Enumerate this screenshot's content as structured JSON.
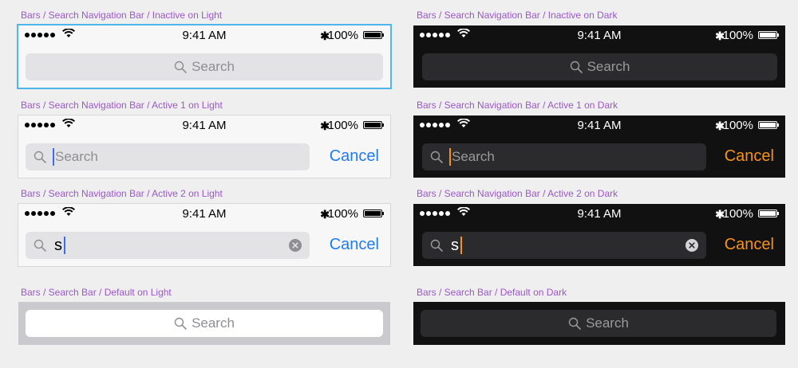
{
  "status_bar": {
    "time": "9:41 AM",
    "battery_pct": "100%",
    "bluetooth": "✱"
  },
  "colors": {
    "label": "#9b57c8",
    "accent_light": "#1e7cf2",
    "accent_dark": "#f69318",
    "selection": "#4db6ea"
  },
  "frames": [
    {
      "label": "Bars / Search Navigation Bar / Inactive on Light",
      "placeholder": "Search"
    },
    {
      "label": "Bars / Search Navigation Bar / Inactive on Dark",
      "placeholder": "Search"
    },
    {
      "label": "Bars / Search Navigation Bar / Active 1 on Light",
      "placeholder": "Search",
      "cancel": "Cancel"
    },
    {
      "label": "Bars / Search Navigation Bar / Active 1 on Dark",
      "placeholder": "Search",
      "cancel": "Cancel"
    },
    {
      "label": "Bars / Search Navigation Bar / Active 2 on Light",
      "typed": "s",
      "cancel": "Cancel"
    },
    {
      "label": "Bars / Search Navigation Bar / Active 2 on Dark",
      "typed": "s",
      "cancel": "Cancel"
    },
    {
      "label": "Bars / Search Bar / Default on Light",
      "placeholder": "Search"
    },
    {
      "label": "Bars / Search Bar / Default on Dark",
      "placeholder": "Search"
    }
  ]
}
